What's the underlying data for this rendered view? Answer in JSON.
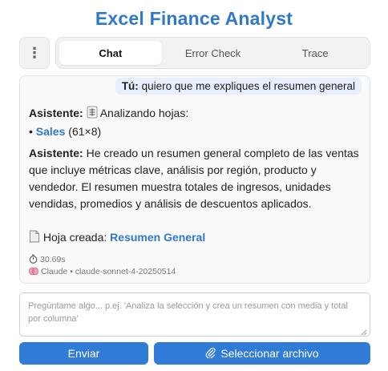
{
  "app": {
    "title": "Excel Finance Analyst"
  },
  "menu": {
    "icon": "⋮"
  },
  "tabs": [
    {
      "label": "Chat",
      "active": true
    },
    {
      "label": "Error Check",
      "active": false
    },
    {
      "label": "Trace",
      "active": false
    }
  ],
  "chat": {
    "user_message": {
      "speaker": "Tú:",
      "text": "quiero que me expliques el resumen general"
    },
    "assistant_1": {
      "speaker": "Asistente:",
      "text": "Analizando hojas:",
      "sheet_bullet": "•",
      "sheet_name": "Sales",
      "sheet_size": "(61×8)"
    },
    "assistant_2": {
      "speaker": "Asistente:",
      "text": "He creado un resumen general completo de las ventas que incluye métricas clave, análisis por región, producto y vendedor. El resumen muestra totales de ingresos, unidades vendidas, promedios y análisis de descuentos aplicados.",
      "created_label": "Hoja creada:",
      "created_sheet": "Resumen General"
    },
    "meta": {
      "duration": "30.69s",
      "model": "Claude • claude-sonnet-4-20250514"
    }
  },
  "input": {
    "placeholder": "Pregúntame algo... p.ej. 'Analiza la selección y crea un resumen con media y total por columna'"
  },
  "buttons": {
    "send": "Enviar",
    "select_file": "Seleccionar archivo"
  },
  "colors": {
    "accent": "#2f78cf",
    "button": "#2f7bd6",
    "user_bubble": "#e6effb"
  }
}
